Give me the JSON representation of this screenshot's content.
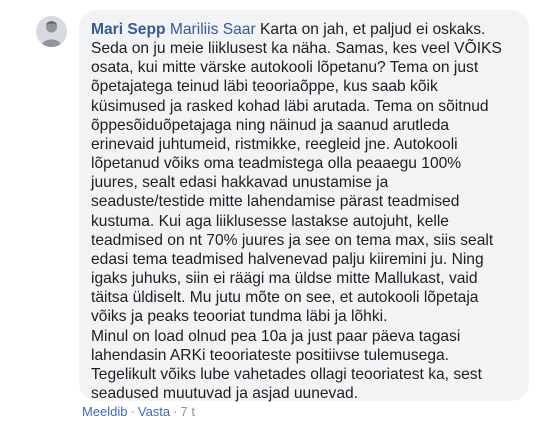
{
  "comment": {
    "author": "Mari Sepp",
    "mention": "Mariliis Saar",
    "first_line_text": "Karta on jah, et paljud ei oskaks.",
    "lines": [
      "Seda on ju meie liiklusest ka näha. Samas, kes veel VÕIKS",
      "osata, kui mitte värske autokooli lõpetanu? Tema on just",
      "õpetajatega teinud läbi teooriaõppe, kus saab kõik",
      "küsimused ja rasked kohad läbi arutada. Tema on sõitnud",
      "õppesõiduõpetajaga ning näinud ja saanud arutleda",
      "erinevaid juhtumeid, ristmikke, reegleid jne. Autokooli",
      "lõpetanud võiks oma teadmistega olla peaaegu 100%",
      "juures, sealt edasi hakkavad unustamise ja",
      "seaduste/testide mitte lahendamise pärast teadmised",
      "kustuma. Kui aga liiklusesse lastakse autojuht, kelle",
      "teadmised on nt 70% juures ja see on tema max, siis sealt",
      "edasi tema teadmised halvenevad palju kiiremini ju. Ning",
      "igaks juhuks, siin ei räägi ma üldse mitte Mallukast, vaid",
      "täitsa üldiselt. Mu jutu mõte on see, et autokooli lõpetaja",
      "võiks ja peaks teooriat tundma läbi ja lõhki.",
      "Minul on load olnud pea 10a ja just paar päeva tagasi",
      "lahendasin ARKi teooriateste positiivse tulemusega.",
      "Tegelikult võiks lube vahetades ollagi teooriatest ka, sest",
      "seadused muutuvad ja asjad uunevad."
    ]
  },
  "actions": {
    "like_label": "Meeldib",
    "separator": "·",
    "reply_label": "Vasta",
    "timestamp": "7 t"
  },
  "colors": {
    "bubble_bg": "#f2f3f5",
    "name_link": "#385898",
    "action_link": "#4267b2",
    "body_text": "#1c1e21",
    "meta_text": "#90949c"
  },
  "icons": {
    "avatar": "user-profile-photo"
  }
}
